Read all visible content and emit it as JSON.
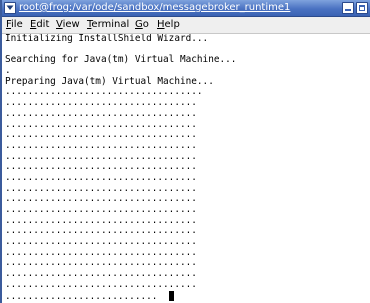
{
  "window": {
    "title": "root@frog:/var/ode/sandbox/messagebroker_runtime1"
  },
  "menubar": {
    "items": [
      {
        "label": "File",
        "mnemonic": "F",
        "rest": "ile"
      },
      {
        "label": "Edit",
        "mnemonic": "E",
        "rest": "dit"
      },
      {
        "label": "View",
        "mnemonic": "V",
        "rest": "iew"
      },
      {
        "label": "Terminal",
        "mnemonic": "T",
        "rest": "erminal"
      },
      {
        "label": "Go",
        "mnemonic": "G",
        "rest": "o"
      },
      {
        "label": "Help",
        "mnemonic": "H",
        "rest": "elp"
      }
    ]
  },
  "terminal": {
    "lines": [
      "Initializing InstallShield Wizard...",
      "",
      "Searching for Java(tm) Virtual Machine...",
      ".",
      "Preparing Java(tm) Virtual Machine...",
      "...................................",
      "..................................",
      "..................................",
      "..................................",
      "..................................",
      "..................................",
      "..................................",
      "..................................",
      "..................................",
      "..................................",
      "..................................",
      "..................................",
      "..................................",
      "..................................",
      "..................................",
      "..................................",
      "..................................",
      "..................................",
      "..................................",
      "...........................  "
    ]
  }
}
